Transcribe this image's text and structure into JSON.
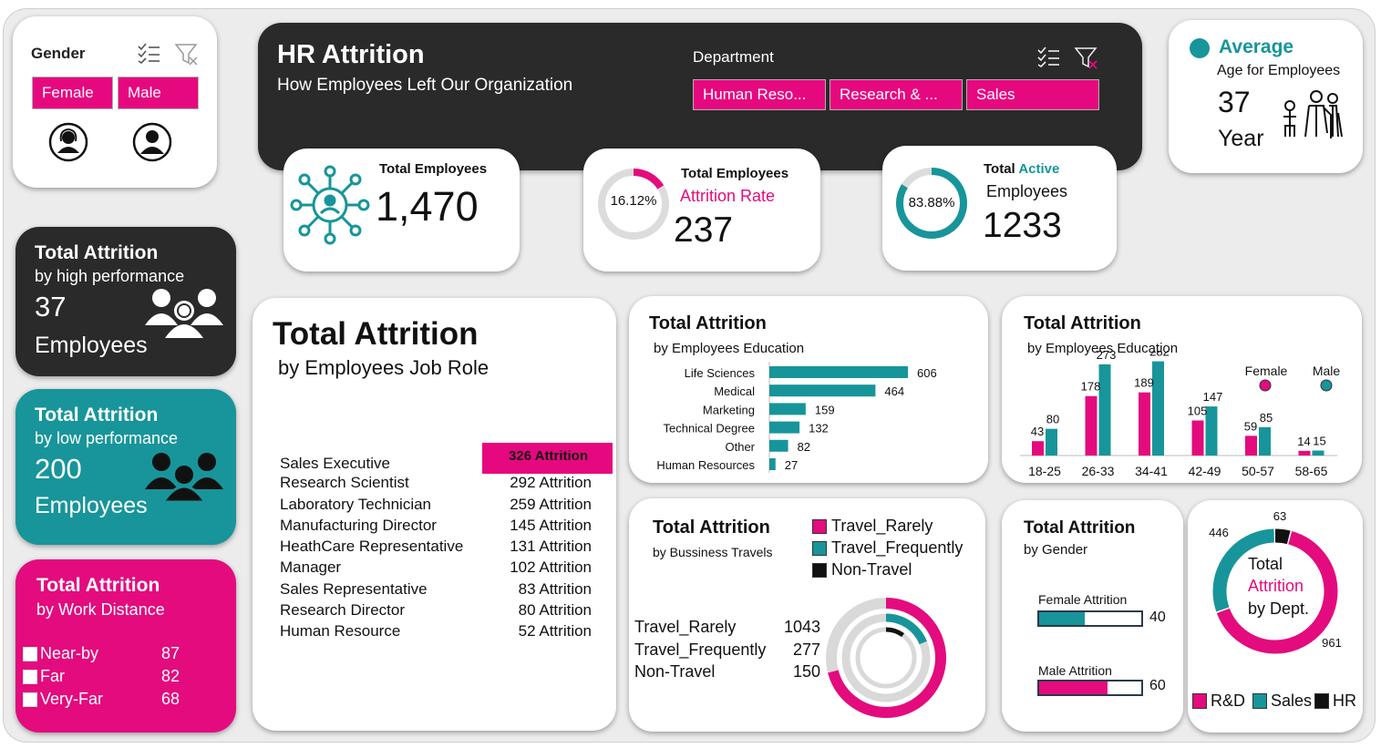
{
  "gender_filter": {
    "title": "Gender",
    "female": "Female",
    "male": "Male"
  },
  "header": {
    "title": "HR Attrition",
    "subtitle": "How Employees Left Our Organization",
    "dept_label": "Department",
    "dept_buttons": [
      "Human Reso...",
      "Research & ...",
      "Sales"
    ]
  },
  "avg_age": {
    "title": "Average",
    "subtitle": "Age for Employees",
    "value": "37",
    "unit": "Year"
  },
  "kpi_total": {
    "title": "Total Employees",
    "value": "1,470"
  },
  "kpi_attrition": {
    "title": "Total Employees",
    "subtitle": "Attrition Rate",
    "value": "237",
    "pct": "16.12%",
    "fraction": 0.1612
  },
  "kpi_active": {
    "title_a": "Total",
    "title_b": "Active",
    "subtitle": "Employees",
    "value": "1233",
    "pct": "83.88%",
    "fraction": 0.8388
  },
  "high_perf": {
    "title": "Total Attrition",
    "subtitle": "by high performance",
    "value": "37",
    "unit": "Employees"
  },
  "low_perf": {
    "title": "Total Attrition",
    "subtitle": "by low performance",
    "value": "200",
    "unit": "Employees"
  },
  "work_distance": {
    "title": "Total Attrition",
    "subtitle": "by Work Distance",
    "rows": [
      {
        "label": "Near-by",
        "value": "87"
      },
      {
        "label": "Far",
        "value": "82"
      },
      {
        "label": "Very-Far",
        "value": "68"
      }
    ]
  },
  "job_role": {
    "title": "Total Attrition",
    "subtitle": "by Employees Job Role",
    "rows": [
      {
        "role": "Sales Executive",
        "value": "326  Attrition"
      },
      {
        "role": "Research Scientist",
        "value": "292 Attrition"
      },
      {
        "role": "Laboratory Technician",
        "value": "259 Attrition"
      },
      {
        "role": "Manufacturing Director",
        "value": "145 Attrition"
      },
      {
        "role": "HeathCare Representative",
        "value": "131 Attrition"
      },
      {
        "role": "Manager",
        "value": "102 Attrition"
      },
      {
        "role": "Sales Representative",
        "value": "83 Attrition"
      },
      {
        "role": "Research Director",
        "value": "80 Attrition"
      },
      {
        "role": "Human Resource",
        "value": "52 Attrition"
      }
    ]
  },
  "travel": {
    "title": "Total Attrition",
    "subtitle": "by Bussiness Travels",
    "legend": [
      "Travel_Rarely",
      "Travel_Frequently",
      "Non-Travel"
    ],
    "rows": [
      {
        "label": "Travel_Rarely",
        "value": "1043"
      },
      {
        "label": "Travel_Frequently",
        "value": "277"
      },
      {
        "label": "Non-Travel",
        "value": "150"
      }
    ]
  },
  "gender_attr": {
    "title": "Total Attrition",
    "subtitle": "by Gender",
    "female_label": "Female Attrition",
    "female_value": "40",
    "male_label": "Male Attrition",
    "male_value": "60"
  },
  "dept_donut": {
    "line1": "Total",
    "line2": "Attrition",
    "line3": "by Dept.",
    "legend": [
      "R&D",
      "Sales",
      "HR"
    ]
  },
  "colors": {
    "pink": "#e30b7d",
    "teal": "#17959a",
    "dark": "#2a2a2a",
    "grey": "#d9d9d9"
  },
  "chart_data": [
    {
      "type": "bar",
      "title": "Total Attrition",
      "subtitle": "by Employees Education",
      "categories": [
        "Life Sciences",
        "Medical",
        "Marketing",
        "Technical Degree",
        "Other",
        "Human Resources"
      ],
      "values": [
        606,
        464,
        159,
        132,
        82,
        27
      ]
    },
    {
      "type": "bar",
      "title": "Total Attrition",
      "subtitle": "by Employees Education",
      "categories": [
        "18-25",
        "26-33",
        "34-41",
        "42-49",
        "50-57",
        "58-65"
      ],
      "series": [
        {
          "name": "Female",
          "values": [
            43,
            178,
            189,
            105,
            59,
            14
          ]
        },
        {
          "name": "Male",
          "values": [
            80,
            273,
            282,
            147,
            85,
            15
          ]
        }
      ]
    },
    {
      "type": "pie",
      "categories": [
        "Travel_Rarely",
        "Travel_Frequently",
        "Non-Travel"
      ],
      "values": [
        1043,
        277,
        150
      ]
    },
    {
      "type": "bar",
      "categories": [
        "Female Attrition",
        "Male Attrition"
      ],
      "values": [
        40,
        60
      ]
    },
    {
      "type": "pie",
      "categories": [
        "R&D",
        "Sales",
        "HR"
      ],
      "values": [
        961,
        446,
        63
      ]
    }
  ]
}
